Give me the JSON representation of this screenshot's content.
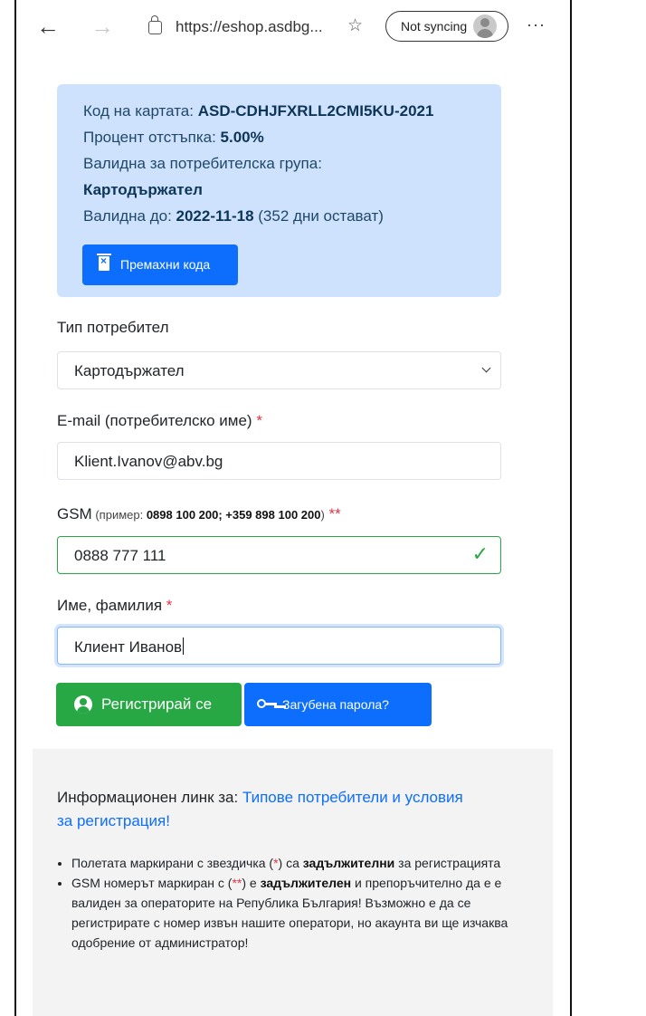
{
  "browser": {
    "url": "https://eshop.asdbg...",
    "sync_label": "Not syncing",
    "more_label": "···",
    "icons": {
      "back": "arrow-left-icon",
      "forward": "arrow-right-icon",
      "lock": "lock-icon",
      "favorite": "favorites-icon",
      "more": "more-icon"
    }
  },
  "card_info": {
    "code_label": "Код на картата: ",
    "code_value": "ASD-CDHJFXRLL2CMI5KU-2021",
    "discount_label": "Процент отстъпка: ",
    "discount_value": "5.00%",
    "group_label": "Валидна за потребителска група:",
    "group_value": "Картодържател",
    "valid_label": "Валидна до: ",
    "valid_date": "2022-11-18",
    "valid_remaining": " (352 дни остават)",
    "remove_button": "Премахни кода"
  },
  "form": {
    "user_type": {
      "label": "Тип потребител",
      "value": "Картодържател"
    },
    "email": {
      "label": "E-mail (потребителско име)",
      "required_mark": " *",
      "value": "Klient.Ivanov@abv.bg"
    },
    "gsm": {
      "label": "GSM",
      "hint_prefix": " (пример: ",
      "hint_example": "0898 100 200; +359 898 100 200",
      "hint_suffix": ")",
      "required_mark": " **",
      "value": "0888 777 111"
    },
    "name": {
      "label": "Име, фамилия",
      "required_mark": " *",
      "value": "Клиент Иванов"
    },
    "register_button": "Регистрирай се",
    "lost_password_button": "Загубена парола?"
  },
  "info": {
    "text": "Информационен линк за: ",
    "link": "Типове потребители и условия за регистрация!",
    "rules": [
      {
        "a": "Полетата маркирани с звездичка (",
        "mark": "*",
        "b": ") са ",
        "strong": "задължителни",
        "c": " за регистрацията"
      },
      {
        "a": "GSM номерът маркиран с (",
        "mark": "**",
        "b": ") е ",
        "strong": "задължителен",
        "c": " и препоръчително да е е валиден за операторите на Република България! Възможно е да се регистрирате с номер извън нашите оператори, но акаунта ви ще изчаква одобрение от администратор!"
      }
    ]
  },
  "colors": {
    "accent": "#0d6efd",
    "success": "#28a745",
    "alert_bg": "#cfe2fd",
    "required": "#dc3545"
  }
}
